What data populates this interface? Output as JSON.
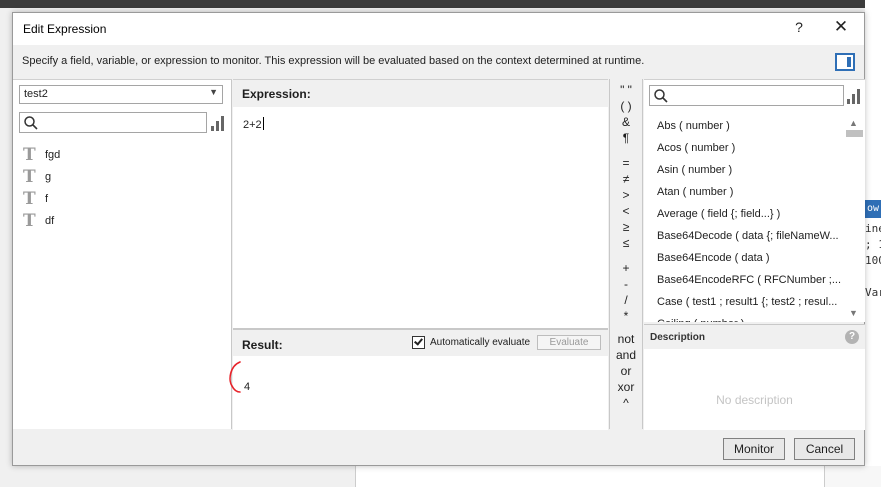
{
  "window": {
    "title": "Edit Expression",
    "help_label": "?",
    "close_label": "✕"
  },
  "instructions": "Specify a field, variable, or expression to monitor. This expression will be evaluated based on the context determined at runtime.",
  "left": {
    "datasource": "test2",
    "search_placeholder": "",
    "fields": [
      "fgd",
      "g",
      "f",
      "df"
    ]
  },
  "expression": {
    "label": "Expression:",
    "value": "2+2"
  },
  "result": {
    "label": "Result:",
    "auto_evaluate_label": "Automatically evaluate",
    "auto_evaluate_checked": true,
    "evaluate_label": "Evaluate",
    "value": "4"
  },
  "operators": [
    "\" \"",
    "( )",
    "&",
    "¶",
    "=",
    "≠",
    ">",
    "<",
    "≥",
    "≤",
    "+",
    "-",
    "/",
    "*",
    "not",
    "and",
    "or",
    "xor",
    "^"
  ],
  "functions": {
    "search_placeholder": "",
    "items": [
      "Abs ( number )",
      "Acos ( number )",
      "Asin ( number )",
      "Atan ( number )",
      "Average ( field {; field...} )",
      "Base64Decode ( data {; fileNameW...",
      "Base64Encode ( data )",
      "Base64EncodeRFC ( RFCNumber ;...",
      "Case ( test1 ; result1 {; test2 ; resul...",
      "Ceiling ( number )"
    ]
  },
  "description": {
    "label": "Description",
    "help_label": "?",
    "empty_text": "No description"
  },
  "footer": {
    "monitor_label": "Monitor",
    "cancel_label": "Cancel"
  },
  "background": {
    "code_lines": [
      "ow",
      "ine",
      "; 1",
      "100",
      "",
      "Var"
    ]
  },
  "colors": {
    "accent": "#2f6fb6",
    "annotation": "#e8232a"
  }
}
